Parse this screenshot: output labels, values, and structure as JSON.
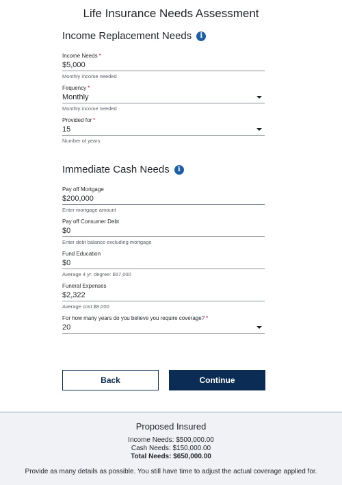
{
  "page": {
    "title": "Life Insurance Needs Assessment"
  },
  "income_section": {
    "heading": "Income Replacement Needs",
    "info_icon": "info-icon",
    "fields": [
      {
        "label": "Income Needs",
        "required": "*",
        "value": "$5,000",
        "helper": "Monthly income needed"
      },
      {
        "label": "Fequency",
        "required": "*",
        "value": "Monthly",
        "helper": "Monthly income needed"
      },
      {
        "label": "Provided for",
        "required": "*",
        "value": "15",
        "helper": "Number of years"
      }
    ]
  },
  "cash_section": {
    "heading": "Immediate Cash Needs",
    "info_icon": "info-icon",
    "fields": [
      {
        "label": "Pay off Mortgage",
        "value": "$200,000",
        "helper": "Enter mortgage amount"
      },
      {
        "label": "Pay off Consumer Debt",
        "value": "$0",
        "helper": "Enter debt balance excluding mortgage"
      },
      {
        "label": "Fund Education",
        "value": "$0",
        "helper": "Average 4 yr. degree: $57,000"
      },
      {
        "label": "Funeral Expenses",
        "value": "$2,322",
        "helper": "Average cost $8,000"
      },
      {
        "label": "For how many years do you believe you require coverage?",
        "required": "*",
        "value": "20"
      }
    ]
  },
  "buttons": {
    "back": "Back",
    "continue": "Continue"
  },
  "summary": {
    "title": "Proposed Insured",
    "income_needs": "Income Needs: $500,000.00",
    "cash_needs": "Cash Needs: $150,000.00",
    "total_needs": "Total Needs: $650,000.00",
    "note": "Provide as many details as possible. You still have time to adjust the actual coverage applied for."
  },
  "colors": {
    "primary": "#0b2d55",
    "info": "#1f5fa8",
    "required": "#c8102e",
    "summary_bg": "#f0f2f5"
  }
}
